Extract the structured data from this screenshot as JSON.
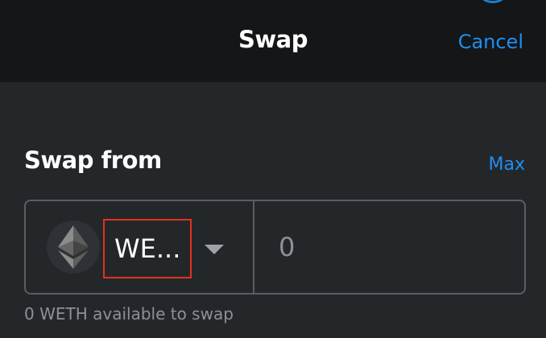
{
  "header": {
    "title": "Swap",
    "cancel_label": "Cancel"
  },
  "swap_from": {
    "label": "Swap from",
    "max_label": "Max",
    "token_symbol": "WE...",
    "token_icon": "ethereum-icon",
    "amount_placeholder": "0",
    "available_text": "0 WETH available to swap"
  },
  "colors": {
    "header_bg": "#141618",
    "body_bg": "#24272a",
    "accent": "#1f8ef1",
    "highlight": "#e2321a"
  }
}
